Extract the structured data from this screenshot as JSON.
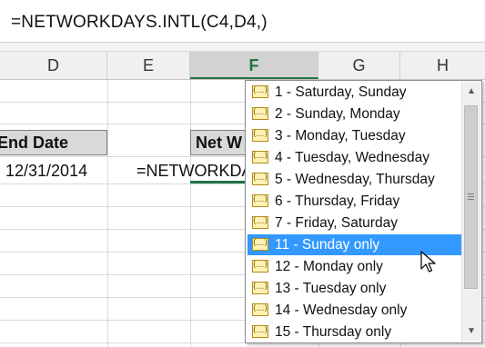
{
  "formula_bar": {
    "text": "=NETWORKDAYS.INTL(C4,D4,)"
  },
  "columns": [
    "D",
    "E",
    "F",
    "G",
    "H"
  ],
  "active_column": "F",
  "cells": {
    "d_header": "End Date",
    "d_value": "12/31/2014",
    "f_header": "Net W",
    "e_formula": "=NETWORKDA"
  },
  "dropdown": {
    "items": [
      "1 - Saturday, Sunday",
      "2 - Sunday, Monday",
      "3 - Monday, Tuesday",
      "4 - Tuesday, Wednesday",
      "5 - Wednesday, Thursday",
      "6 - Thursday, Friday",
      "7 - Friday, Saturday",
      "11 - Sunday only",
      "12 - Monday only",
      "13 - Tuesday only",
      "14 - Wednesday only",
      "15 - Thursday only"
    ],
    "selected_item": "11 - Sunday only",
    "item_icon": "enum-value-icon"
  },
  "colors": {
    "accent": "#217346",
    "selection": "#3399ff"
  }
}
